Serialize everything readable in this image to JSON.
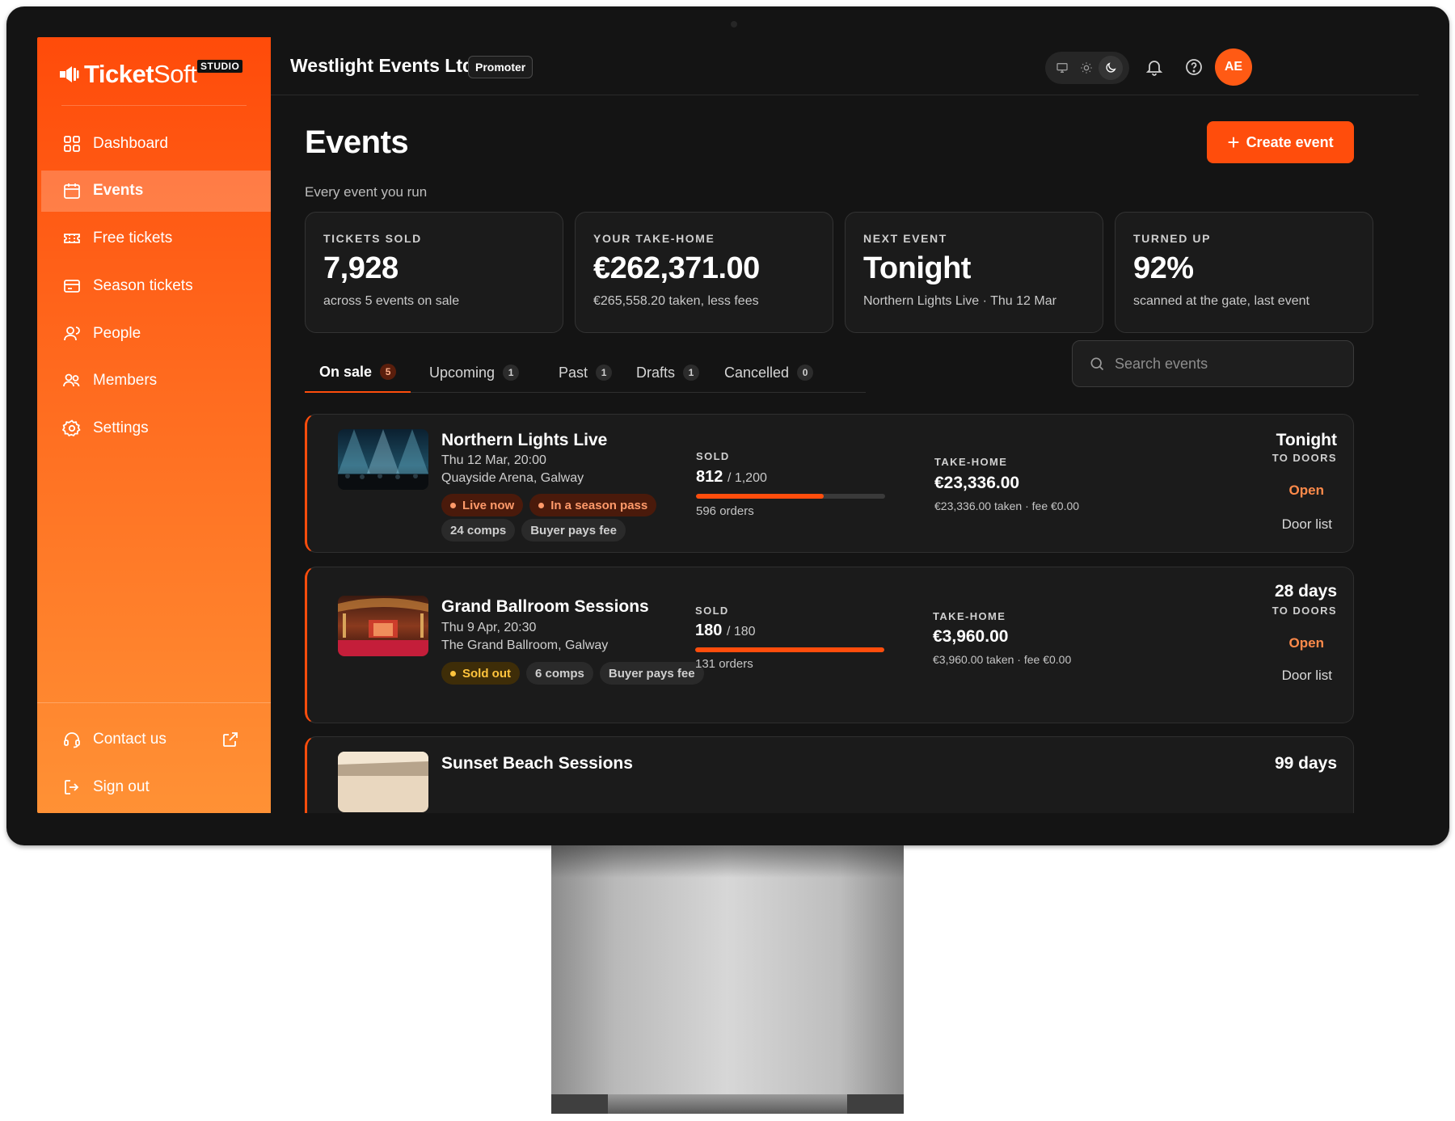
{
  "brand": {
    "name_bold": "Ticket",
    "name_light": "Soft",
    "badge": "STUDIO"
  },
  "sidebar": {
    "items": [
      {
        "label": "Dashboard",
        "icon": "grid-icon",
        "active": false
      },
      {
        "label": "Events",
        "icon": "calendar-icon",
        "active": true
      },
      {
        "label": "Free tickets",
        "icon": "ticket-icon",
        "active": false
      },
      {
        "label": "Season tickets",
        "icon": "card-icon",
        "active": false
      },
      {
        "label": "People",
        "icon": "person-icon",
        "active": false
      },
      {
        "label": "Members",
        "icon": "users-icon",
        "active": false
      },
      {
        "label": "Settings",
        "icon": "gear-icon",
        "active": false
      }
    ],
    "contact": "Contact us",
    "signout": "Sign out"
  },
  "topbar": {
    "org": "Westlight Events Ltd.",
    "role": "Promoter",
    "avatar": "AE",
    "theme": "dark"
  },
  "page": {
    "title": "Events",
    "subtitle": "Every event you run",
    "create_label": "Create event"
  },
  "stats": [
    {
      "label": "TICKETS SOLD",
      "value": "7,928",
      "note": "across 5 events on sale"
    },
    {
      "label": "YOUR TAKE-HOME",
      "value": "€262,371.00",
      "note": "€265,558.20 taken, less fees"
    },
    {
      "label": "NEXT EVENT",
      "value": "Tonight",
      "note": "Northern Lights Live · Thu 12 Mar"
    },
    {
      "label": "TURNED UP",
      "value": "92%",
      "note": "scanned at the gate, last event"
    }
  ],
  "tabs": [
    {
      "label": "On sale",
      "count": "5",
      "active": true
    },
    {
      "label": "Upcoming",
      "count": "1",
      "active": false
    },
    {
      "label": "Past",
      "count": "1",
      "active": false
    },
    {
      "label": "Drafts",
      "count": "1",
      "active": false
    },
    {
      "label": "Cancelled",
      "count": "0",
      "active": false
    }
  ],
  "search": {
    "placeholder": "Search events"
  },
  "events": [
    {
      "title": "Northern Lights Live",
      "datetime": "Thu 12 Mar, 20:00",
      "venue": "Quayside Arena, Galway",
      "status_chips": [
        "Live now",
        "In a season pass"
      ],
      "info_chips": [
        "24 comps",
        "Buyer pays fee"
      ],
      "sold_label": "SOLD",
      "sold": "812",
      "capacity": "/ 1,200",
      "sold_fraction": 0.677,
      "orders": "596 orders",
      "take_label": "TAKE-HOME",
      "take_home": "€23,336.00",
      "take_note": "€23,336.00 taken · fee €0.00",
      "countdown": "Tonight",
      "doors_label": "TO DOORS",
      "open_label": "Open",
      "door_list_label": "Door list"
    },
    {
      "title": "Grand Ballroom Sessions",
      "datetime": "Thu 9 Apr, 20:30",
      "venue": "The Grand Ballroom, Galway",
      "status_chips": [
        "Sold out"
      ],
      "info_chips": [
        "6 comps",
        "Buyer pays fee"
      ],
      "sold_label": "SOLD",
      "sold": "180",
      "capacity": "/ 180",
      "sold_fraction": 1.0,
      "orders": "131 orders",
      "take_label": "TAKE-HOME",
      "take_home": "€3,960.00",
      "take_note": "€3,960.00 taken · fee €0.00",
      "countdown": "28 days",
      "doors_label": "TO DOORS",
      "open_label": "Open",
      "door_list_label": "Door list"
    },
    {
      "title": "Sunset Beach Sessions",
      "countdown": "99 days"
    }
  ],
  "colors": {
    "accent": "#ff4d0c",
    "sidebar_top": "#ff4b0a",
    "sidebar_bottom": "#ff9135",
    "background": "#141414"
  }
}
